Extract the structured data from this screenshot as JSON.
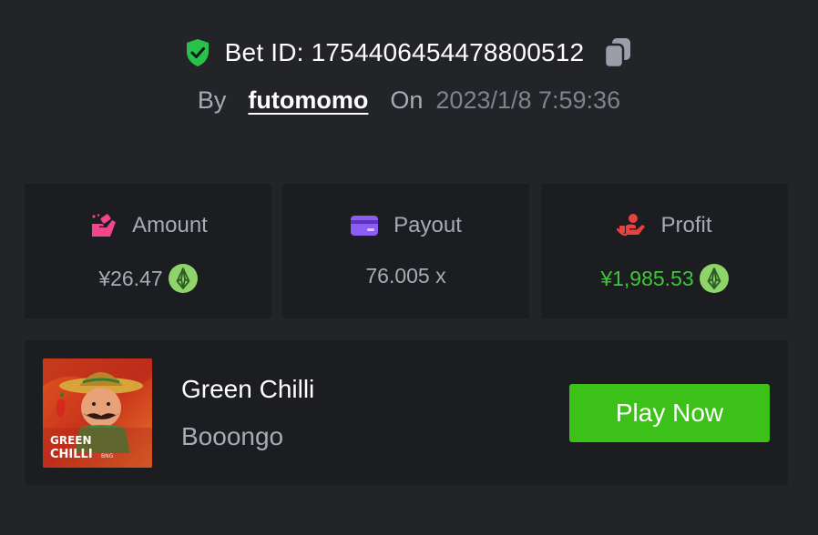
{
  "header": {
    "bet_id_text": "Bet ID: 1754406454478800512",
    "by_label": "By",
    "username": "futomomo",
    "on_label": "On",
    "date": "2023/1/8 7:59:36"
  },
  "stats": {
    "amount": {
      "label": "Amount",
      "value": "¥26.47",
      "icon": "hand-money-icon",
      "icon_color": "#f0468c",
      "coin": "eos-coin-icon"
    },
    "payout": {
      "label": "Payout",
      "value": "76.005 x",
      "icon": "card-icon",
      "icon_color": "#8c5cf5"
    },
    "profit": {
      "label": "Profit",
      "value": "¥1,985.53",
      "icon": "hand-coins-icon",
      "icon_color": "#e8413e",
      "coin": "eos-coin-icon"
    }
  },
  "game": {
    "title": "Green Chilli",
    "provider": "Booongo",
    "play_label": "Play Now",
    "thumbnail_text_line1": "GREEN",
    "thumbnail_text_line2": "CHILLI",
    "thumbnail_brand": "BNG"
  },
  "colors": {
    "background": "#232428",
    "card": "#1c1d20",
    "accent_green": "#3bc117",
    "profit_green": "#3fc53a",
    "shield_green": "#27c24c",
    "coin_green": "#8fd36b"
  }
}
